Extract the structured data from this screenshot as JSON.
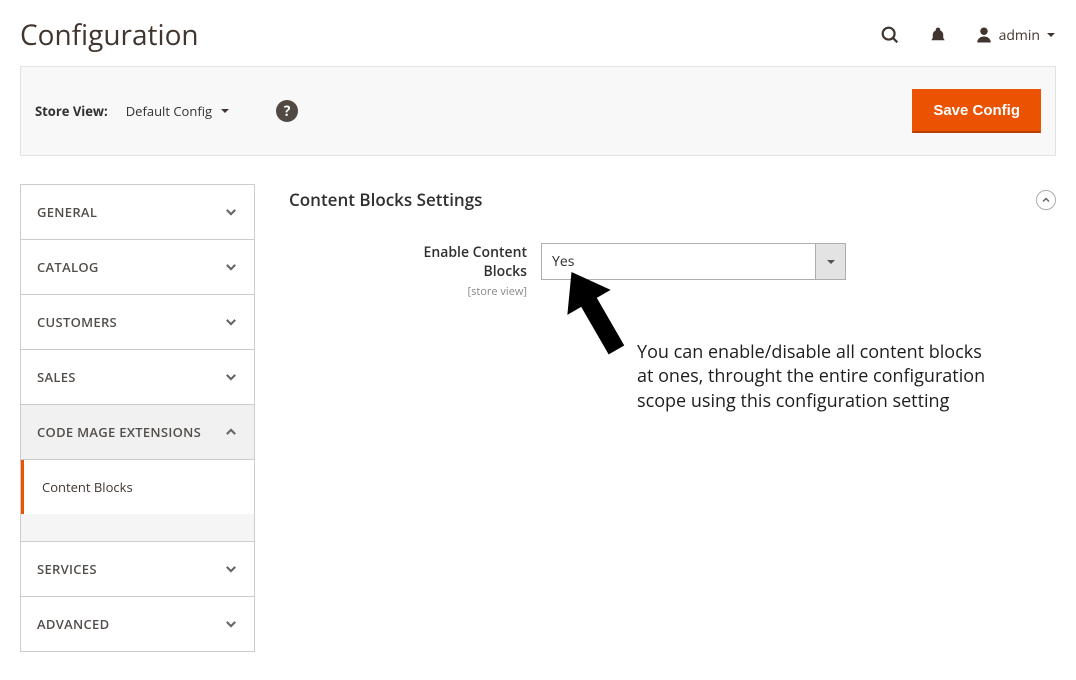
{
  "header": {
    "title": "Configuration",
    "admin_label": "admin"
  },
  "toolbar": {
    "store_view_label": "Store View:",
    "store_view_value": "Default Config",
    "save_label": "Save Config"
  },
  "sidebar": {
    "items": [
      {
        "label": "GENERAL",
        "expanded": false
      },
      {
        "label": "CATALOG",
        "expanded": false
      },
      {
        "label": "CUSTOMERS",
        "expanded": false
      },
      {
        "label": "SALES",
        "expanded": false
      },
      {
        "label": "CODE MAGE EXTENSIONS",
        "expanded": true,
        "children": [
          {
            "label": "Content Blocks"
          }
        ]
      },
      {
        "label": "SERVICES",
        "expanded": false
      },
      {
        "label": "ADVANCED",
        "expanded": false
      }
    ]
  },
  "section": {
    "title": "Content Blocks Settings",
    "field_label": "Enable Content Blocks",
    "field_scope": "[store view]",
    "field_value": "Yes"
  },
  "annotation": {
    "text": "You can enable/disable all content blocks at ones, throught the entire configuration scope using this configuration setting"
  }
}
